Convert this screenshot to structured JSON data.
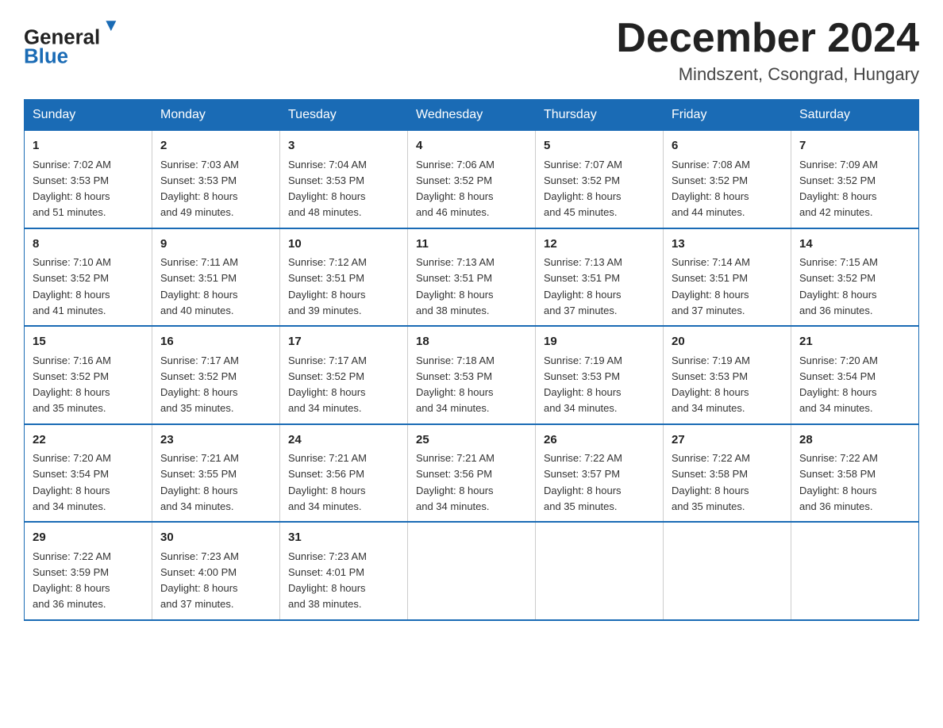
{
  "header": {
    "logo_general": "General",
    "logo_blue": "Blue",
    "title": "December 2024",
    "subtitle": "Mindszent, Csongrad, Hungary"
  },
  "days_of_week": [
    "Sunday",
    "Monday",
    "Tuesday",
    "Wednesday",
    "Thursday",
    "Friday",
    "Saturday"
  ],
  "weeks": [
    [
      {
        "day": "1",
        "sunrise": "7:02 AM",
        "sunset": "3:53 PM",
        "daylight": "8 hours and 51 minutes."
      },
      {
        "day": "2",
        "sunrise": "7:03 AM",
        "sunset": "3:53 PM",
        "daylight": "8 hours and 49 minutes."
      },
      {
        "day": "3",
        "sunrise": "7:04 AM",
        "sunset": "3:53 PM",
        "daylight": "8 hours and 48 minutes."
      },
      {
        "day": "4",
        "sunrise": "7:06 AM",
        "sunset": "3:52 PM",
        "daylight": "8 hours and 46 minutes."
      },
      {
        "day": "5",
        "sunrise": "7:07 AM",
        "sunset": "3:52 PM",
        "daylight": "8 hours and 45 minutes."
      },
      {
        "day": "6",
        "sunrise": "7:08 AM",
        "sunset": "3:52 PM",
        "daylight": "8 hours and 44 minutes."
      },
      {
        "day": "7",
        "sunrise": "7:09 AM",
        "sunset": "3:52 PM",
        "daylight": "8 hours and 42 minutes."
      }
    ],
    [
      {
        "day": "8",
        "sunrise": "7:10 AM",
        "sunset": "3:52 PM",
        "daylight": "8 hours and 41 minutes."
      },
      {
        "day": "9",
        "sunrise": "7:11 AM",
        "sunset": "3:51 PM",
        "daylight": "8 hours and 40 minutes."
      },
      {
        "day": "10",
        "sunrise": "7:12 AM",
        "sunset": "3:51 PM",
        "daylight": "8 hours and 39 minutes."
      },
      {
        "day": "11",
        "sunrise": "7:13 AM",
        "sunset": "3:51 PM",
        "daylight": "8 hours and 38 minutes."
      },
      {
        "day": "12",
        "sunrise": "7:13 AM",
        "sunset": "3:51 PM",
        "daylight": "8 hours and 37 minutes."
      },
      {
        "day": "13",
        "sunrise": "7:14 AM",
        "sunset": "3:51 PM",
        "daylight": "8 hours and 37 minutes."
      },
      {
        "day": "14",
        "sunrise": "7:15 AM",
        "sunset": "3:52 PM",
        "daylight": "8 hours and 36 minutes."
      }
    ],
    [
      {
        "day": "15",
        "sunrise": "7:16 AM",
        "sunset": "3:52 PM",
        "daylight": "8 hours and 35 minutes."
      },
      {
        "day": "16",
        "sunrise": "7:17 AM",
        "sunset": "3:52 PM",
        "daylight": "8 hours and 35 minutes."
      },
      {
        "day": "17",
        "sunrise": "7:17 AM",
        "sunset": "3:52 PM",
        "daylight": "8 hours and 34 minutes."
      },
      {
        "day": "18",
        "sunrise": "7:18 AM",
        "sunset": "3:53 PM",
        "daylight": "8 hours and 34 minutes."
      },
      {
        "day": "19",
        "sunrise": "7:19 AM",
        "sunset": "3:53 PM",
        "daylight": "8 hours and 34 minutes."
      },
      {
        "day": "20",
        "sunrise": "7:19 AM",
        "sunset": "3:53 PM",
        "daylight": "8 hours and 34 minutes."
      },
      {
        "day": "21",
        "sunrise": "7:20 AM",
        "sunset": "3:54 PM",
        "daylight": "8 hours and 34 minutes."
      }
    ],
    [
      {
        "day": "22",
        "sunrise": "7:20 AM",
        "sunset": "3:54 PM",
        "daylight": "8 hours and 34 minutes."
      },
      {
        "day": "23",
        "sunrise": "7:21 AM",
        "sunset": "3:55 PM",
        "daylight": "8 hours and 34 minutes."
      },
      {
        "day": "24",
        "sunrise": "7:21 AM",
        "sunset": "3:56 PM",
        "daylight": "8 hours and 34 minutes."
      },
      {
        "day": "25",
        "sunrise": "7:21 AM",
        "sunset": "3:56 PM",
        "daylight": "8 hours and 34 minutes."
      },
      {
        "day": "26",
        "sunrise": "7:22 AM",
        "sunset": "3:57 PM",
        "daylight": "8 hours and 35 minutes."
      },
      {
        "day": "27",
        "sunrise": "7:22 AM",
        "sunset": "3:58 PM",
        "daylight": "8 hours and 35 minutes."
      },
      {
        "day": "28",
        "sunrise": "7:22 AM",
        "sunset": "3:58 PM",
        "daylight": "8 hours and 36 minutes."
      }
    ],
    [
      {
        "day": "29",
        "sunrise": "7:22 AM",
        "sunset": "3:59 PM",
        "daylight": "8 hours and 36 minutes."
      },
      {
        "day": "30",
        "sunrise": "7:23 AM",
        "sunset": "4:00 PM",
        "daylight": "8 hours and 37 minutes."
      },
      {
        "day": "31",
        "sunrise": "7:23 AM",
        "sunset": "4:01 PM",
        "daylight": "8 hours and 38 minutes."
      },
      null,
      null,
      null,
      null
    ]
  ],
  "labels": {
    "sunrise": "Sunrise:",
    "sunset": "Sunset:",
    "daylight": "Daylight:"
  }
}
